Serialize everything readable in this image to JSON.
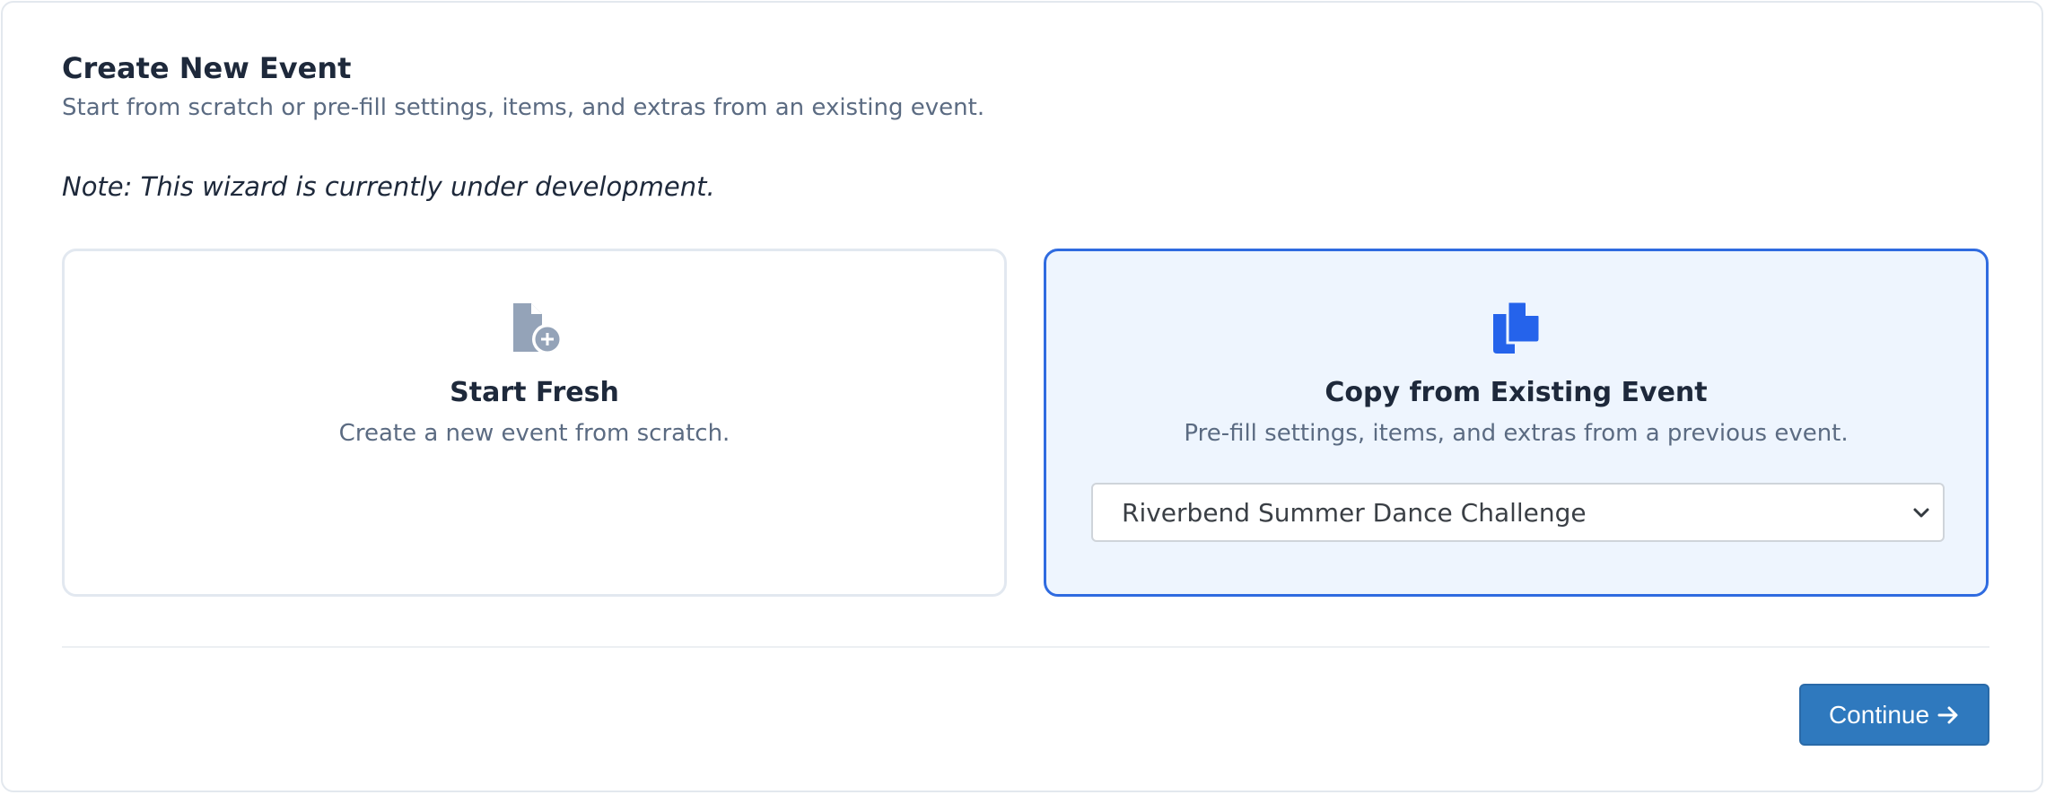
{
  "header": {
    "title": "Create New Event",
    "subtitle": "Start from scratch or pre-fill settings, items, and extras from an existing event.",
    "note": "Note: This wizard is currently under development."
  },
  "options": {
    "fresh": {
      "title": "Start Fresh",
      "description": "Create a new event from scratch.",
      "icon": "file-plus-icon",
      "selected": false
    },
    "copy": {
      "title": "Copy from Existing Event",
      "description": "Pre-fill settings, items, and extras from a previous event.",
      "icon": "copy-icon",
      "selected": true,
      "event_select": {
        "value": "Riverbend Summer Dance Challenge"
      }
    }
  },
  "footer": {
    "continue_label": "Continue"
  },
  "colors": {
    "accent": "#2f6be0",
    "selected_bg": "#eef5fe",
    "button": "#2f79be",
    "muted_icon": "#94a3b8"
  }
}
